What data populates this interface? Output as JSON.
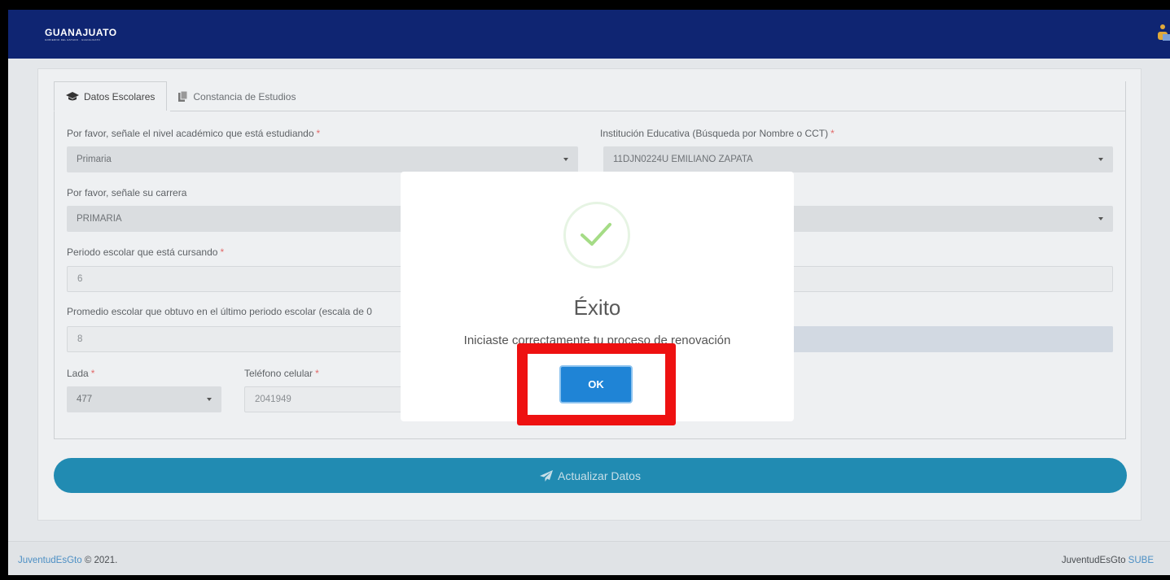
{
  "header": {
    "brand": "GUANAJUATO",
    "brand_sub": "GOBIERNO DEL ESTADO · GUANAJUATO"
  },
  "tabs": [
    {
      "label": "Datos Escolares",
      "icon": "graduation-cap-icon",
      "active": true
    },
    {
      "label": "Constancia de Estudios",
      "icon": "documents-icon",
      "active": false
    }
  ],
  "form": {
    "nivel": {
      "label": "Por favor, señale el nivel académico que está estudiando",
      "value": "Primaria"
    },
    "institucion": {
      "label": "Institución Educativa (Búsqueda por Nombre o CCT)",
      "value": "11DJN0224U EMILIANO ZAPATA"
    },
    "carrera": {
      "label": "Por favor, señale su carrera",
      "value": "PRIMARIA"
    },
    "periodo": {
      "label": "Periodo escolar que está cursando",
      "value": "6"
    },
    "promedio": {
      "label": "Promedio escolar que obtuvo en el último periodo escolar (escala de 0",
      "value": "8"
    },
    "lada": {
      "label": "Lada",
      "value": "477"
    },
    "telefono": {
      "label": "Teléfono celular",
      "value": "2041949"
    }
  },
  "update_button": "Actualizar Datos",
  "footer": {
    "left_link": "JuventudEsGto",
    "left_text": " © 2021.",
    "right_text": "JuventudEsGto ",
    "right_link": "SUBE"
  },
  "modal": {
    "title": "Éxito",
    "message": "Iniciaste correctamente tu proceso de renovación",
    "ok": "OK"
  },
  "colors": {
    "navbar": "#0f2572",
    "primary_button": "#218bb2",
    "ok_button": "#1f84d6",
    "highlight": "#ee1111",
    "success": "#a5dc86"
  }
}
